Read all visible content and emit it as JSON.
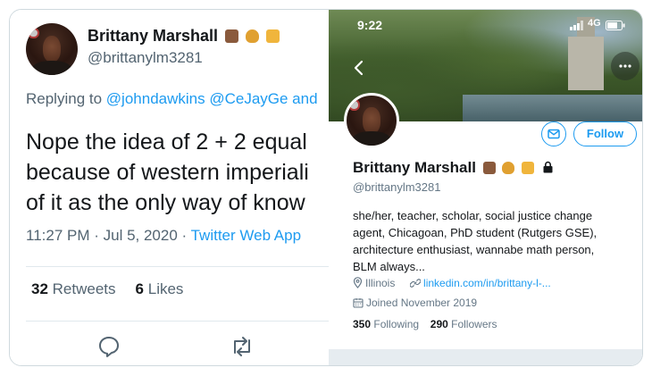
{
  "tweet": {
    "author_name": "Brittany Marshall",
    "author_handle": "@brittanylm3281",
    "replying_prefix": "Replying to",
    "replying_mentions": "@johndawkins @CeJayGe and",
    "text_lines": [
      "Nope the idea of 2 + 2 equal",
      "because of western imperiali",
      "of it as the only way of know"
    ],
    "time": "11:27 PM · Jul 5, 2020 ·",
    "source": "Twitter Web App",
    "retweets_count": "32",
    "retweets_label": "Retweets",
    "likes_count": "6",
    "likes_label": "Likes",
    "icons": [
      "reply-icon",
      "retweet-icon"
    ]
  },
  "phone": {
    "time": "9:22",
    "network": "4G"
  },
  "profile": {
    "follow_label": "Follow",
    "name": "Brittany Marshall",
    "handle": "@brittanylm3281",
    "bio_lines": [
      "she/her, teacher, scholar, social justice change",
      "agent, Chicagoan, PhD student (Rutgers GSE),",
      "architecture enthusiast, wannabe math person,",
      "BLM always..."
    ],
    "location": "Illinois",
    "website": "linkedin.com/in/brittany-l-...",
    "joined": "Joined November 2019",
    "following_count": "350",
    "following_label": "Following",
    "followers_count": "290",
    "followers_label": "Followers",
    "icons": [
      "back-icon",
      "more-icon",
      "message-icon",
      "lock-icon",
      "location-icon",
      "link-icon",
      "calendar-icon"
    ]
  },
  "colors": {
    "accent": "#1d9bf0",
    "secondary_text": "#536471"
  }
}
